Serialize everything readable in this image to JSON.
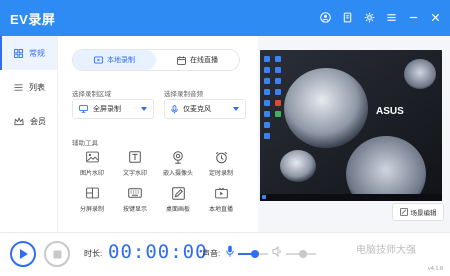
{
  "app": {
    "title": "EV录屏",
    "version": "v4.1.8"
  },
  "sidebar": {
    "items": [
      {
        "label": "常规",
        "icon": "grid-icon",
        "active": true
      },
      {
        "label": "列表",
        "icon": "list-icon",
        "active": false
      },
      {
        "label": "会员",
        "icon": "crown-icon",
        "active": false
      }
    ]
  },
  "tabs": [
    {
      "label": "本地录制",
      "active": true
    },
    {
      "label": "在线直播",
      "active": false
    }
  ],
  "record_area": {
    "label": "选择录制区域",
    "value": "全屏录制"
  },
  "audio": {
    "label": "选择录制音频",
    "value": "仅麦克风"
  },
  "tools": {
    "title": "辅助工具",
    "items": [
      {
        "label": "图片水印",
        "icon": "image-icon"
      },
      {
        "label": "文字水印",
        "icon": "text-icon"
      },
      {
        "label": "嵌入摄像头",
        "icon": "camera-icon"
      },
      {
        "label": "定时录制",
        "icon": "alarm-icon"
      },
      {
        "label": "分屏录制",
        "icon": "split-screen-icon"
      },
      {
        "label": "按键显示",
        "icon": "keyboard-icon"
      },
      {
        "label": "桌面画板",
        "icon": "pen-board-icon"
      },
      {
        "label": "本地直播",
        "icon": "broadcast-icon"
      }
    ]
  },
  "preview": {
    "scene_button": "场景编辑",
    "screen_brand": "ASUS"
  },
  "bottom": {
    "duration_label": "时长:",
    "timer": "00:00:00",
    "volume_label": "声音:",
    "mic_level": 0.55,
    "system_level": 0.55
  },
  "watermark": "电脑技师大强",
  "colors": {
    "accent": "#2f6df6",
    "titlebar": "#2f8bf4"
  }
}
